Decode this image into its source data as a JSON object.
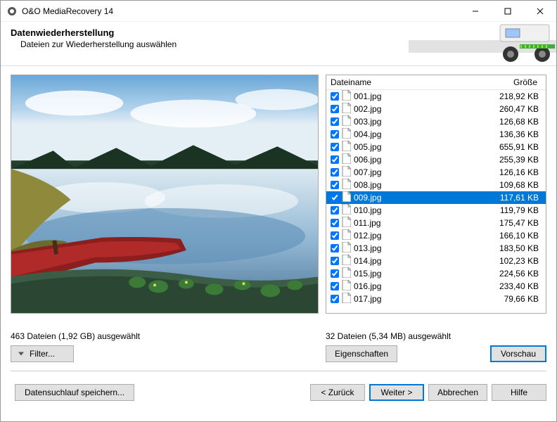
{
  "window": {
    "title": "O&O MediaRecovery 14"
  },
  "header": {
    "title": "Datenwiederherstellung",
    "subtitle": "Dateien zur Wiederherstellung auswählen"
  },
  "columns": {
    "name": "Dateiname",
    "size": "Größe"
  },
  "files": [
    {
      "name": "001.jpg",
      "size": "218,92 KB",
      "checked": true,
      "selected": false
    },
    {
      "name": "002.jpg",
      "size": "260,47 KB",
      "checked": true,
      "selected": false
    },
    {
      "name": "003.jpg",
      "size": "126,68 KB",
      "checked": true,
      "selected": false
    },
    {
      "name": "004.jpg",
      "size": "136,36 KB",
      "checked": true,
      "selected": false
    },
    {
      "name": "005.jpg",
      "size": "655,91 KB",
      "checked": true,
      "selected": false
    },
    {
      "name": "006.jpg",
      "size": "255,39 KB",
      "checked": true,
      "selected": false
    },
    {
      "name": "007.jpg",
      "size": "126,16 KB",
      "checked": true,
      "selected": false
    },
    {
      "name": "008.jpg",
      "size": "109,68 KB",
      "checked": true,
      "selected": false
    },
    {
      "name": "009.jpg",
      "size": "117,61 KB",
      "checked": true,
      "selected": true
    },
    {
      "name": "010.jpg",
      "size": "119,79 KB",
      "checked": true,
      "selected": false
    },
    {
      "name": "011.jpg",
      "size": "175,47 KB",
      "checked": true,
      "selected": false
    },
    {
      "name": "012.jpg",
      "size": "166,10 KB",
      "checked": true,
      "selected": false
    },
    {
      "name": "013.jpg",
      "size": "183,50 KB",
      "checked": true,
      "selected": false
    },
    {
      "name": "014.jpg",
      "size": "102,23 KB",
      "checked": true,
      "selected": false
    },
    {
      "name": "015.jpg",
      "size": "224,56 KB",
      "checked": true,
      "selected": false
    },
    {
      "name": "016.jpg",
      "size": "233,40 KB",
      "checked": true,
      "selected": false
    },
    {
      "name": "017.jpg",
      "size": "79,66 KB",
      "checked": true,
      "selected": false
    }
  ],
  "status": {
    "left": "463 Dateien (1,92 GB) ausgewählt",
    "right": "32 Dateien (5,34 MB) ausgewählt"
  },
  "buttons": {
    "filter": "Filter...",
    "properties": "Eigenschaften",
    "preview": "Vorschau",
    "save_scan": "Datensuchlauf speichern...",
    "back": "< Zurück",
    "next": "Weiter >",
    "cancel": "Abbrechen",
    "help": "Hilfe"
  }
}
